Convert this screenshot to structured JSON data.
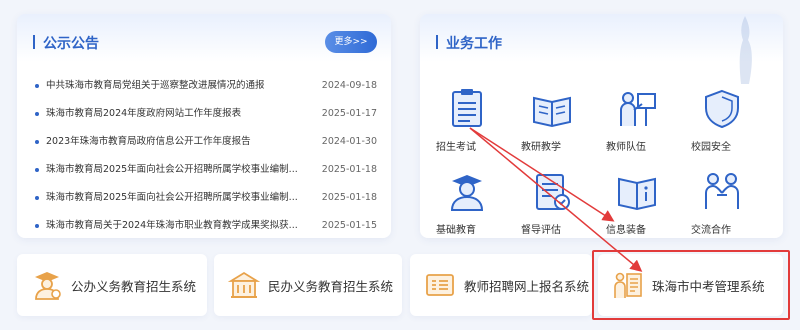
{
  "notice": {
    "title": "公示公告",
    "more_label": "更多>>",
    "items": [
      {
        "title": "中共珠海市教育局党组关于巡察整改进展情况的通报",
        "date": "2024-09-18"
      },
      {
        "title": "珠海市教育局2024年度政府网站工作年度报表",
        "date": "2025-01-17"
      },
      {
        "title": "2023年珠海市教育局政府信息公开工作年度报告",
        "date": "2024-01-30"
      },
      {
        "title": "珠海市教育局2025年面向社会公开招聘所属学校事业编制...",
        "date": "2025-01-18"
      },
      {
        "title": "珠海市教育局2025年面向社会公开招聘所属学校事业编制...",
        "date": "2025-01-18"
      },
      {
        "title": "珠海市教育局关于2024年珠海市职业教育教学成果奖拟获...",
        "date": "2025-01-15"
      }
    ]
  },
  "work": {
    "title": "业务工作",
    "items": [
      {
        "label": "招生考试",
        "icon": "clipboard-icon"
      },
      {
        "label": "教研教学",
        "icon": "open-book-icon"
      },
      {
        "label": "教师队伍",
        "icon": "teacher-icon"
      },
      {
        "label": "校园安全",
        "icon": "shield-icon"
      },
      {
        "label": "基础教育",
        "icon": "student-icon"
      },
      {
        "label": "督导评估",
        "icon": "checklist-icon"
      },
      {
        "label": "信息装备",
        "icon": "info-book-icon"
      },
      {
        "label": "交流合作",
        "icon": "handshake-icon"
      }
    ]
  },
  "systems": [
    {
      "label": "公办义务教育招生系统",
      "icon": "graduate-icon"
    },
    {
      "label": "民办义务教育招生系统",
      "icon": "school-building-icon"
    },
    {
      "label": "教师招聘网上报名系统",
      "icon": "form-list-icon"
    },
    {
      "label": "珠海市中考管理系统",
      "icon": "exam-board-icon"
    }
  ],
  "colors": {
    "accent": "#2f64c7",
    "highlight": "#e23b3b",
    "icon_blue": "#2f64c7",
    "icon_orange": "#e8a24a"
  }
}
